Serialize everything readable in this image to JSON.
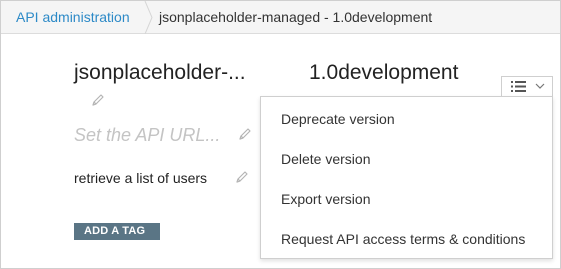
{
  "breadcrumb": {
    "root_label": "API administration",
    "current_label": "jsonplaceholder-managed - 1.0development"
  },
  "api": {
    "name": "jsonplaceholder-...",
    "version": "1.0development",
    "url_placeholder": "Set the API URL...",
    "description": "retrieve a list of users",
    "add_tag_label": "ADD A TAG"
  },
  "menu": {
    "toggle_icon": "list-icon",
    "items": [
      {
        "label": "Deprecate version"
      },
      {
        "label": "Delete version"
      },
      {
        "label": "Export version"
      },
      {
        "label": "Request API access terms & conditions"
      }
    ]
  },
  "colors": {
    "link": "#2d8ac7",
    "tag_button_bg": "#5a7585",
    "placeholder": "#c4c4c4",
    "breadcrumb_bg": "#f5f5f5"
  }
}
